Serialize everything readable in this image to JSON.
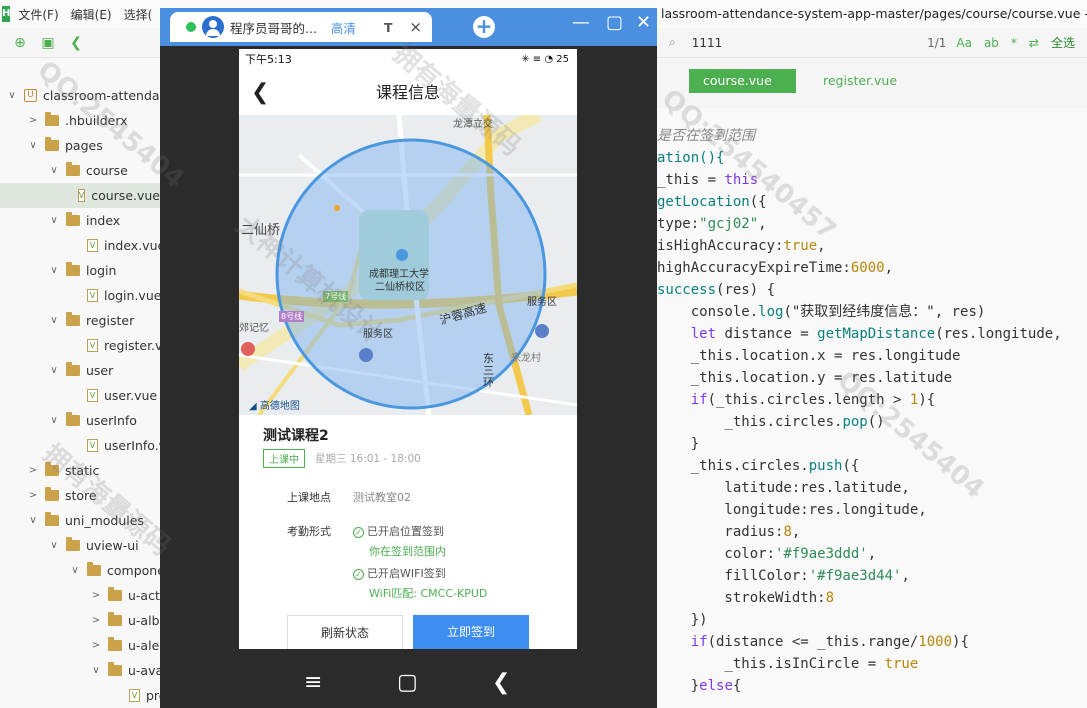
{
  "menubar": {
    "logo": "H",
    "items": [
      "文件(F)",
      "编辑(E)",
      "选择("
    ]
  },
  "window_title": "lassroom-attendance-system-app-master/pages/course/course.vue - HBuil",
  "find": {
    "query": "1111",
    "count": "1/1",
    "options": [
      "Aa",
      "ab",
      "*",
      "⇄"
    ],
    "select_all": "全选"
  },
  "editor_tabs": {
    "active": "course.vue",
    "inactive": "register.vue"
  },
  "tree": [
    {
      "label": "classroom-attendance",
      "kind": "proj",
      "arrow": "∨",
      "indent": 0
    },
    {
      "label": ".hbuilderx",
      "kind": "folder",
      "arrow": ">",
      "indent": 1
    },
    {
      "label": "pages",
      "kind": "folder",
      "arrow": "∨",
      "indent": 1
    },
    {
      "label": "course",
      "kind": "folder",
      "arrow": "∨",
      "indent": 2
    },
    {
      "label": "course.vue",
      "kind": "file",
      "arrow": "",
      "indent": 3,
      "selected": true
    },
    {
      "label": "index",
      "kind": "folder",
      "arrow": "∨",
      "indent": 2
    },
    {
      "label": "index.vue",
      "kind": "file",
      "arrow": "",
      "indent": 3
    },
    {
      "label": "login",
      "kind": "folder",
      "arrow": "∨",
      "indent": 2
    },
    {
      "label": "login.vue",
      "kind": "file",
      "arrow": "",
      "indent": 3
    },
    {
      "label": "register",
      "kind": "folder",
      "arrow": "∨",
      "indent": 2
    },
    {
      "label": "register.vu",
      "kind": "file",
      "arrow": "",
      "indent": 3
    },
    {
      "label": "user",
      "kind": "folder",
      "arrow": "∨",
      "indent": 2
    },
    {
      "label": "user.vue",
      "kind": "file",
      "arrow": "",
      "indent": 3
    },
    {
      "label": "userInfo",
      "kind": "folder",
      "arrow": "∨",
      "indent": 2
    },
    {
      "label": "userInfo.vu",
      "kind": "file",
      "arrow": "",
      "indent": 3
    },
    {
      "label": "static",
      "kind": "folder",
      "arrow": ">",
      "indent": 1
    },
    {
      "label": "store",
      "kind": "folder",
      "arrow": ">",
      "indent": 1
    },
    {
      "label": "uni_modules",
      "kind": "folder",
      "arrow": "∨",
      "indent": 1
    },
    {
      "label": "uview-ui",
      "kind": "folder",
      "arrow": "∨",
      "indent": 2
    },
    {
      "label": "componen",
      "kind": "folder",
      "arrow": "∨",
      "indent": 3
    },
    {
      "label": "u-actio",
      "kind": "folder",
      "arrow": ">",
      "indent": 4
    },
    {
      "label": "u-albur",
      "kind": "folder",
      "arrow": ">",
      "indent": 4
    },
    {
      "label": "u-alert",
      "kind": "folder",
      "arrow": ">",
      "indent": 4
    },
    {
      "label": "u-avata",
      "kind": "folder",
      "arrow": "∨",
      "indent": 4
    },
    {
      "label": "pro",
      "kind": "file",
      "arrow": "",
      "indent": 5
    }
  ],
  "code_lines": [
    [
      {
        "t": "是否在签到范围",
        "c": "cm"
      }
    ],
    [
      {
        "t": "ation(){",
        "c": "fn"
      }
    ],
    [
      {
        "t": "_this",
        "c": "prop"
      },
      {
        "t": " = ",
        "c": "prop"
      },
      {
        "t": "this",
        "c": "kw"
      }
    ],
    [
      {
        "t": "getLocation",
        "c": "fn"
      },
      {
        "t": "({",
        "c": "prop"
      }
    ],
    [
      {
        "t": "type:",
        "c": "prop"
      },
      {
        "t": "\"gcj02\"",
        "c": "str"
      },
      {
        "t": ",",
        "c": "prop"
      }
    ],
    [
      {
        "t": "isHighAccuracy:",
        "c": "prop"
      },
      {
        "t": "true",
        "c": "num"
      },
      {
        "t": ",",
        "c": "prop"
      }
    ],
    [
      {
        "t": "highAccuracyExpireTime:",
        "c": "prop"
      },
      {
        "t": "6000",
        "c": "num"
      },
      {
        "t": ",",
        "c": "prop"
      }
    ],
    [
      {
        "t": "success",
        "c": "fn"
      },
      {
        "t": "(res) {",
        "c": "prop"
      }
    ],
    [
      {
        "t": "    console.",
        "c": "prop"
      },
      {
        "t": "log",
        "c": "fn"
      },
      {
        "t": "(\"获取到经纬度信息：\", res)",
        "c": "prop"
      }
    ],
    [
      {
        "t": "    ",
        "c": "prop"
      },
      {
        "t": "let",
        "c": "kw"
      },
      {
        "t": " distance = ",
        "c": "prop"
      },
      {
        "t": "getMapDistance",
        "c": "fn"
      },
      {
        "t": "(res.longitude,",
        "c": "prop"
      }
    ],
    [
      {
        "t": "    _this.location.x = res.longitude",
        "c": "prop"
      }
    ],
    [
      {
        "t": "    _this.location.y = res.latitude",
        "c": "prop"
      }
    ],
    [
      {
        "t": "    ",
        "c": "prop"
      },
      {
        "t": "if",
        "c": "kw"
      },
      {
        "t": "(_this.circles.length > ",
        "c": "prop"
      },
      {
        "t": "1",
        "c": "num"
      },
      {
        "t": "){",
        "c": "prop"
      }
    ],
    [
      {
        "t": "        _this.circles.",
        "c": "prop"
      },
      {
        "t": "pop",
        "c": "fn"
      },
      {
        "t": "()",
        "c": "prop"
      }
    ],
    [
      {
        "t": "    }",
        "c": "prop"
      }
    ],
    [
      {
        "t": "    _this.circles.",
        "c": "prop"
      },
      {
        "t": "push",
        "c": "fn"
      },
      {
        "t": "({",
        "c": "prop"
      }
    ],
    [
      {
        "t": "        latitude:res.latitude,",
        "c": "prop"
      }
    ],
    [
      {
        "t": "        longitude:res.longitude,",
        "c": "prop"
      }
    ],
    [
      {
        "t": "        radius:",
        "c": "prop"
      },
      {
        "t": "8",
        "c": "num"
      },
      {
        "t": ",",
        "c": "prop"
      }
    ],
    [
      {
        "t": "        color:",
        "c": "prop"
      },
      {
        "t": "'#f9ae3ddd'",
        "c": "str"
      },
      {
        "t": ",",
        "c": "prop"
      }
    ],
    [
      {
        "t": "        fillColor:",
        "c": "prop"
      },
      {
        "t": "'#f9ae3d44'",
        "c": "str"
      },
      {
        "t": ",",
        "c": "prop"
      }
    ],
    [
      {
        "t": "        strokeWidth:",
        "c": "prop"
      },
      {
        "t": "8",
        "c": "num"
      }
    ],
    [
      {
        "t": "    })",
        "c": "prop"
      }
    ],
    [
      {
        "t": "    ",
        "c": "prop"
      },
      {
        "t": "if",
        "c": "kw"
      },
      {
        "t": "(distance <= _this.range/",
        "c": "prop"
      },
      {
        "t": "1000",
        "c": "num"
      },
      {
        "t": "){",
        "c": "prop"
      }
    ],
    [
      {
        "t": "        _this.isInCircle = ",
        "c": "prop"
      },
      {
        "t": "true",
        "c": "num"
      }
    ],
    [
      {
        "t": "    }",
        "c": "prop"
      },
      {
        "t": "else",
        "c": "kw"
      },
      {
        "t": "{",
        "c": "prop"
      }
    ]
  ],
  "phone_window": {
    "tab_title": "程序员哥哥的...",
    "quality": "高清",
    "t_label": "T",
    "close": "×",
    "add": "+",
    "minimize": "—",
    "maximize": "▢",
    "win_close": "✕"
  },
  "phone": {
    "time": "下午5:13",
    "status_right": "✳ ≡ ◔ 25",
    "nav_title": "课程信息",
    "map": {
      "labels": {
        "top": "龙潭立交",
        "left": "二仙桥",
        "school1": "成都理工大学",
        "school2": "二仙桥校区",
        "service_right": "服务区",
        "service_bottom": "服务区",
        "highway": "沪蓉高速",
        "ring": "东三环",
        "village": "来龙村",
        "poi_left": "郊记忆",
        "road1": "7号线",
        "road2": "8号线",
        "logo": "高德地图"
      }
    },
    "course": {
      "title": "测试课程2",
      "status": "上课中",
      "time": "星期三 16:01 - 18:00",
      "location_label": "上课地点",
      "location_value": "测试教室02",
      "attend_label": "考勤形式",
      "location_sign": "已开启位置签到",
      "in_range": "你在签到范围内",
      "wifi_sign": "已开启WIFI签到",
      "wifi_match": "WiFi匹配: CMCC-KPUD"
    },
    "buttons": {
      "refresh": "刷新状态",
      "sign": "立即签到"
    },
    "nav_keys": [
      "≡",
      "▢",
      "❮"
    ]
  },
  "watermarks": [
    "QQ:2545404",
    "大神计算机设计",
    "拥有海量源码",
    "QQ:254540457"
  ]
}
